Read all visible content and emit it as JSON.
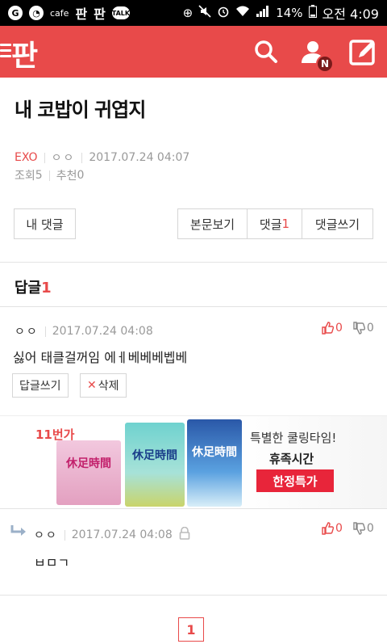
{
  "status_bar": {
    "cafe_label": "cafe",
    "pann_1": "판",
    "pann_2": "판",
    "talk_label": "TALK",
    "battery_pct": "14%",
    "time": "오전 4:09"
  },
  "header": {
    "logo": "판",
    "notification_badge": "N",
    "brand_color": "#e84a4a"
  },
  "post": {
    "title": "내 코밥이 귀엽지",
    "category": "EXO",
    "author": "ㅇㅇ",
    "datetime": "2017.07.24 04:07",
    "views_label": "조회",
    "views": "5",
    "recommend_label": "추천",
    "recommend": "0"
  },
  "buttons": {
    "my_comments": "내 댓글",
    "view_body": "본문보기",
    "comments_label": "댓글",
    "comments_count": "1",
    "write_comment": "댓글쓰기"
  },
  "replies": {
    "heading": "답글",
    "count": "1"
  },
  "comments": [
    {
      "author": "ㅇㅇ",
      "datetime": "2017.07.24 04:08",
      "text": "싫어 태클걸꺼임 에ㅔ베베베벱베",
      "up": "0",
      "down": "0",
      "reply_btn": "답글쓰기",
      "delete_btn": "삭제"
    },
    {
      "author": "ㅇㅇ",
      "datetime": "2017.07.24 04:08",
      "text": "ㅂㅁㄱ",
      "up": "0",
      "down": "0"
    }
  ],
  "ad": {
    "badge": "11번가",
    "product_a": "休足時間",
    "product_b": "休足時間",
    "product_c": "休足時間",
    "line1": "특별한 쿨링타임!",
    "line2": "휴족시간",
    "cta": "한정특가"
  },
  "pagination": {
    "current": "1"
  }
}
